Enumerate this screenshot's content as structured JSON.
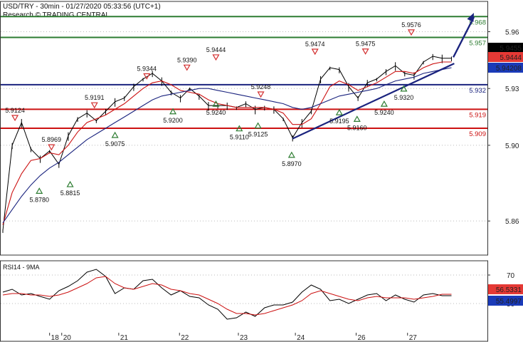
{
  "header": {
    "title": "USD/TRY - 30min - 01/27/2020 05:33:56 (UTC+1)",
    "source": "Research © TRADING CENTRAL"
  },
  "colors": {
    "price": "#000000",
    "ma_red": "#cc1111",
    "ma_blue": "#1a237e",
    "resistance": "#2e7d32",
    "pivot": "#1a237e",
    "support": "#cc1111",
    "arrow": "#1a237e",
    "current_price_bg": "#000000",
    "ma_red_label_bg": "#e53935",
    "ma_blue_label_bg": "#1a3ab8"
  },
  "chart_data": [
    {
      "type": "line",
      "panel": "price",
      "x_ticks": [
        "18",
        "20",
        "21",
        "22",
        "23",
        "24",
        "26",
        "27"
      ],
      "y_ticks": [
        5.86,
        5.9,
        5.93,
        5.96
      ],
      "ylim": [
        5.842,
        5.976
      ],
      "grid": true,
      "series": [
        {
          "values": [
            5.855,
            5.9,
            5.912,
            5.898,
            5.893,
            5.897,
            5.89,
            5.905,
            5.914,
            5.917,
            5.913,
            5.918,
            5.923,
            5.925,
            5.931,
            5.935,
            5.938,
            5.934,
            5.928,
            5.925,
            5.93,
            5.926,
            5.921,
            5.921,
            5.921,
            5.92,
            5.922,
            5.919,
            5.92,
            5.919,
            5.914,
            5.904,
            5.912,
            5.918,
            5.935,
            5.941,
            5.94,
            5.931,
            5.925,
            5.933,
            5.935,
            5.939,
            5.942,
            5.938,
            5.937,
            5.944,
            5.947,
            5.946,
            5.946
          ]
        },
        {
          "values": [
            5.858,
            5.875,
            5.885,
            5.892,
            5.893,
            5.896,
            5.895,
            5.9,
            5.907,
            5.912,
            5.914,
            5.916,
            5.919,
            5.922,
            5.926,
            5.93,
            5.933,
            5.934,
            5.932,
            5.929,
            5.928,
            5.927,
            5.924,
            5.922,
            5.921,
            5.92,
            5.92,
            5.92,
            5.92,
            5.919,
            5.917,
            5.911,
            5.911,
            5.914,
            5.922,
            5.931,
            5.934,
            5.932,
            5.929,
            5.931,
            5.933,
            5.936,
            5.939,
            5.939,
            5.938,
            5.941,
            5.943,
            5.944,
            5.944
          ]
        },
        {
          "values": [
            5.859,
            5.866,
            5.873,
            5.879,
            5.884,
            5.888,
            5.891,
            5.895,
            5.899,
            5.903,
            5.906,
            5.909,
            5.912,
            5.915,
            5.918,
            5.921,
            5.924,
            5.926,
            5.927,
            5.928,
            5.929,
            5.93,
            5.93,
            5.929,
            5.928,
            5.927,
            5.926,
            5.925,
            5.924,
            5.923,
            5.922,
            5.92,
            5.919,
            5.92,
            5.922,
            5.924,
            5.926,
            5.927,
            5.928,
            5.929,
            5.93,
            5.932,
            5.934,
            5.935,
            5.936,
            5.938,
            5.939,
            5.94,
            5.941
          ]
        }
      ],
      "levels": [
        {
          "value": 5.968,
          "label": "5.968",
          "role": "resistance"
        },
        {
          "value": 5.957,
          "label": "5.957",
          "role": "resistance"
        },
        {
          "value": 5.932,
          "label": "5.932",
          "role": "pivot"
        },
        {
          "value": 5.919,
          "label": "5.919",
          "role": "support"
        },
        {
          "value": 5.909,
          "label": "5.909",
          "role": "support"
        }
      ],
      "right_labels": [
        {
          "value": 5.9455,
          "label": "5.9455",
          "role": "current_price"
        },
        {
          "value": 5.9444,
          "label": "5.9444",
          "role": "ma_red"
        },
        {
          "value": 5.94208,
          "label": "5.94208",
          "role": "ma_blue"
        }
      ],
      "trendline": {
        "from": [
          31,
          5.9035
        ],
        "to": [
          48.3,
          5.9432
        ]
      },
      "arrow": {
        "from": [
          48.2,
          5.9465
        ],
        "to": [
          50.4,
          5.97
        ]
      },
      "markers": [
        {
          "x": 1.3,
          "value": 5.9124,
          "label": "5.9124",
          "dir": "down"
        },
        {
          "x": 3.9,
          "value": 5.878,
          "label": "5.8780",
          "dir": "up"
        },
        {
          "x": 5.2,
          "value": 5.8969,
          "label": "5.8969",
          "dir": "down"
        },
        {
          "x": 7.2,
          "value": 5.8815,
          "label": "5.8815",
          "dir": "up"
        },
        {
          "x": 9.8,
          "value": 5.9191,
          "label": "5.9191",
          "dir": "down"
        },
        {
          "x": 12.0,
          "value": 5.9075,
          "label": "5.9075",
          "dir": "up"
        },
        {
          "x": 15.4,
          "value": 5.9344,
          "label": "5.9344",
          "dir": "down"
        },
        {
          "x": 18.2,
          "value": 5.92,
          "label": "5.9200",
          "dir": "up"
        },
        {
          "x": 19.7,
          "value": 5.939,
          "label": "5.9390",
          "dir": "down"
        },
        {
          "x": 22.8,
          "value": 5.9444,
          "label": "5.9444",
          "dir": "down"
        },
        {
          "x": 22.8,
          "value": 5.924,
          "label": "5.9240",
          "dir": "up"
        },
        {
          "x": 25.3,
          "value": 5.911,
          "label": "5.9110",
          "dir": "up"
        },
        {
          "x": 27.3,
          "value": 5.9125,
          "label": "5.9125",
          "dir": "up"
        },
        {
          "x": 27.6,
          "value": 5.9248,
          "label": "5.9248",
          "dir": "down"
        },
        {
          "x": 30.9,
          "value": 5.897,
          "label": "5.8970",
          "dir": "up"
        },
        {
          "x": 33.4,
          "value": 5.9474,
          "label": "5.9474",
          "dir": "down"
        },
        {
          "x": 36.0,
          "value": 5.9195,
          "label": "5.9195",
          "dir": "up"
        },
        {
          "x": 37.9,
          "value": 5.916,
          "label": "5.9160",
          "dir": "up"
        },
        {
          "x": 38.8,
          "value": 5.9475,
          "label": "5.9475",
          "dir": "down"
        },
        {
          "x": 40.8,
          "value": 5.924,
          "label": "5.9240",
          "dir": "up"
        },
        {
          "x": 42.9,
          "value": 5.932,
          "label": "5.9320",
          "dir": "up"
        },
        {
          "x": 43.7,
          "value": 5.9576,
          "label": "5.9576",
          "dir": "down"
        }
      ]
    },
    {
      "type": "line",
      "panel": "indicator",
      "title": "RSI14 - 9MA",
      "y_ticks": [
        50,
        70
      ],
      "ylim": [
        30,
        80
      ],
      "grid": true,
      "series": [
        {
          "values": [
            58,
            60,
            56,
            57,
            55,
            53,
            59,
            62,
            66,
            72,
            74,
            69,
            57,
            61,
            60,
            66,
            67,
            61,
            56,
            59,
            55,
            54,
            49,
            46,
            39,
            40,
            44,
            41,
            47,
            49,
            49,
            51,
            58,
            63,
            60,
            52,
            53,
            50,
            53,
            56,
            57,
            52,
            56,
            53,
            51,
            56,
            57,
            55.5,
            55.5
          ]
        },
        {
          "values": [
            56,
            57,
            57,
            56,
            56,
            55,
            56,
            58,
            61,
            64,
            68,
            69,
            64,
            61,
            60,
            62,
            64,
            63,
            60,
            59,
            57,
            56,
            53,
            50,
            46,
            43,
            43,
            42,
            43,
            45,
            47,
            49,
            52,
            57,
            59,
            57,
            55,
            53,
            52,
            54,
            55,
            54,
            54,
            54,
            53,
            54,
            55,
            56.5,
            56.5
          ]
        }
      ],
      "right_labels": [
        {
          "value": 56.5331,
          "label": "56.5331",
          "role": "ma"
        },
        {
          "value": 55.4997,
          "label": "55.4997",
          "role": "rsi"
        }
      ]
    }
  ]
}
